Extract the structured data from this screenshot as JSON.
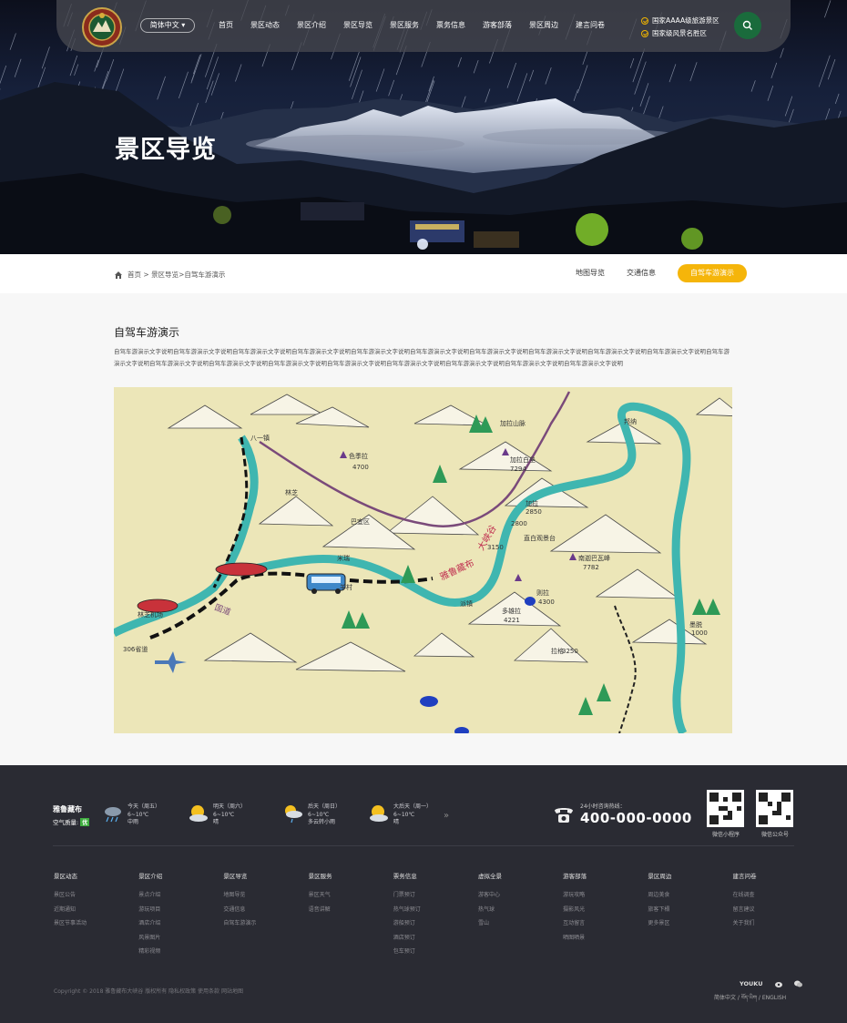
{
  "hero": {
    "title": "景区导览"
  },
  "nav": {
    "lang": "简体中文",
    "menu": [
      "首页",
      "景区动态",
      "景区介绍",
      "景区导览",
      "景区服务",
      "票务信息",
      "游客部落",
      "景区周边",
      "建言问卷"
    ],
    "badges": [
      "国家AAAA级旅游景区",
      "国家级风景名胜区"
    ]
  },
  "breadcrumb": {
    "home": "首页",
    "sep1": " > ",
    "level1": "景区导览",
    "sep2": ">",
    "current": "自驾车游演示"
  },
  "subtabs": [
    "地图导览",
    "交通信息",
    "自驾车游演示"
  ],
  "content": {
    "title": "自驾车游演示",
    "desc": "自驾车游演示文字说明自驾车游演示文字说明自驾车游演示文字说明自驾车游演示文字说明自驾车游演示文字说明自驾车游演示文字说明自驾车游演示文字说明自驾车游演示文字说明自驾车游演示文字说明自驾车游演示文字说明自驾车游演示文字说明自驾车游演示文字说明自驾车游演示文字说明自驾车游演示文字说明自驾车游演示文字说明自驾车游演示文字说明自驾车游演示文字说明自驾车游演示文字说明自驾车游演示文字说明"
  },
  "map": {
    "labels": [
      "加拉山脉",
      "色季拉",
      "4700",
      "八一镇",
      "林芝",
      "加拉白垒",
      "7294",
      "加拉",
      "2850",
      "直白观景台",
      "南迦巴瓦峰",
      "7782",
      "羊村",
      "米瑞",
      "派镇",
      "雅鲁藏布",
      "大峡谷",
      "则拉",
      "4300",
      "墨脱",
      "1000",
      "林芝机场",
      "306省道",
      "国道",
      "2800",
      "3150",
      "多雄拉",
      "4221",
      "拉格",
      "3250",
      "巴宜区",
      "邦纳"
    ]
  },
  "footer": {
    "brand": "雅鲁藏布",
    "aq_label": "空气质量:",
    "aq_value": "优",
    "weather": [
      {
        "day": "今天（周五）",
        "temp": "6~10℃",
        "desc": "中雨"
      },
      {
        "day": "明天（周六）",
        "temp": "6~10℃",
        "desc": "晴"
      },
      {
        "day": "后天（周日）",
        "temp": "6~10℃",
        "desc": "多云转小雨"
      },
      {
        "day": "大后天（周一）",
        "temp": "6~10℃",
        "desc": "晴"
      }
    ],
    "more": "»",
    "hotline_label": "24小时咨询热线：",
    "hotline": "400-000-0000",
    "qr": [
      "微信小程序",
      "微信公众号"
    ],
    "columns": [
      {
        "head": "景区动态",
        "items": [
          "景区公告",
          "近期通知",
          "景区节事活动"
        ]
      },
      {
        "head": "景区介绍",
        "items": [
          "景点介绍",
          "游玩项目",
          "酒店介绍",
          "风景图片",
          "精彩视频"
        ]
      },
      {
        "head": "景区导览",
        "items": [
          "地图导览",
          "交通信息",
          "自驾车游演示"
        ]
      },
      {
        "head": "景区服务",
        "items": [
          "景区天气",
          "语音讲解"
        ]
      },
      {
        "head": "票务信息",
        "items": [
          "门票预订",
          "热气球预订",
          "游船预订",
          "酒店预订",
          "包车预订"
        ]
      },
      {
        "head": "虚拟全景",
        "items": [
          "游客中心",
          "热气球",
          "雪山"
        ]
      },
      {
        "head": "游客部落",
        "items": [
          "游玩攻略",
          "摄影风光",
          "互动留言",
          "晒图晒景"
        ]
      },
      {
        "head": "景区周边",
        "items": [
          "周边美食",
          "旅客下榻",
          "更多景区"
        ]
      },
      {
        "head": "建言问卷",
        "items": [
          "在线调查",
          "留言建议",
          "关于我们"
        ]
      }
    ],
    "copyright": "Copyright © 2018 雅鲁藏布大峡谷  版权所有  隐私权政策  使用条款  网站地图",
    "youku": "YOUKU",
    "langs": "简体中文 / བོད་ཡིག / ENGLISH"
  }
}
